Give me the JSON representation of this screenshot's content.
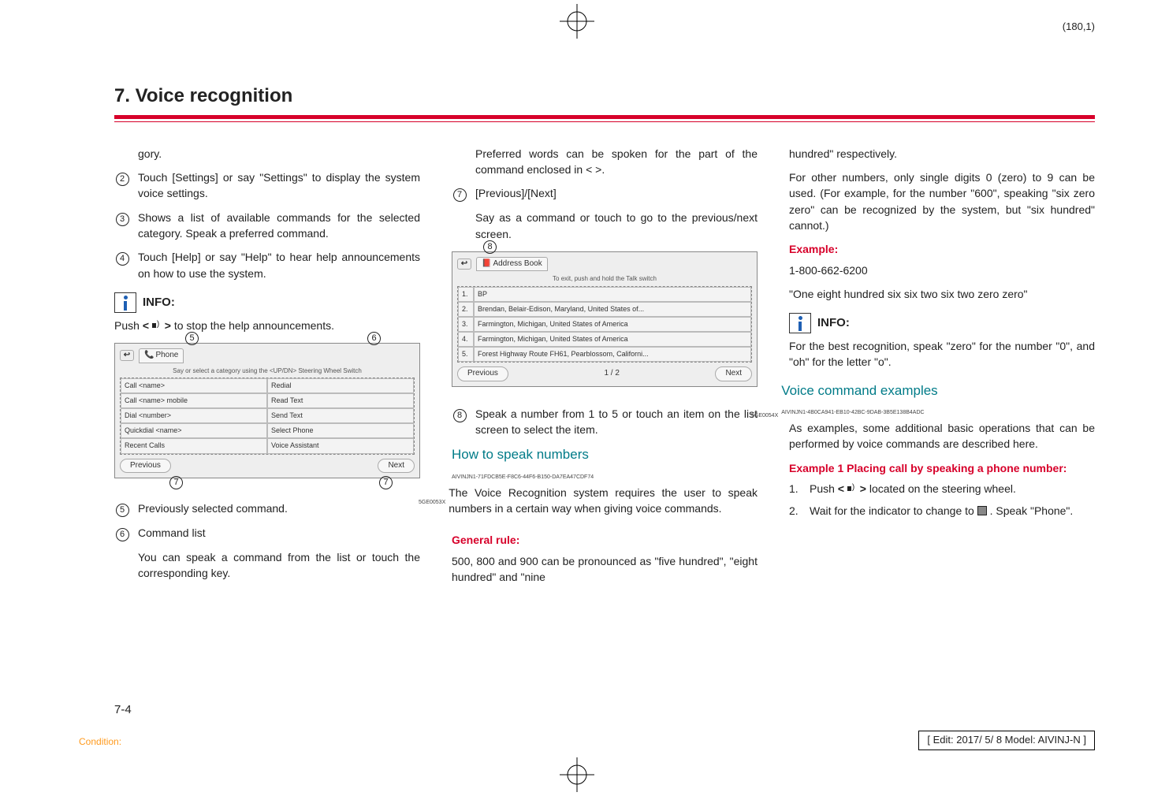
{
  "page_coord": "(180,1)",
  "chapter": "7. Voice recognition",
  "page_number": "7-4",
  "condition_label": "Condition:",
  "edit_line": "[ Edit: 2017/ 5/ 8    Model:  AIVINJ-N ]",
  "col1": {
    "gory": "gory.",
    "i2": "Touch [Settings] or say \"Settings\" to display the system voice settings.",
    "i3": "Shows a list of available commands for the selected category. Speak a preferred command.",
    "i4": "Touch [Help] or say \"Help\" to hear help announcements on how to use the system.",
    "info_label": "INFO:",
    "info_text_pre": "Push ",
    "info_text_mid": " to stop the help announcements.",
    "bold_lt": "<",
    "bold_gt": ">",
    "ss1": {
      "tab": "Phone",
      "hint": "Say or select a category using the <UP/DN> Steering Wheel Switch",
      "r1a": "Call <name>",
      "r1b": "Redial",
      "r2a": "Call <name> mobile",
      "r2b": "Read Text",
      "r3a": "Dial <number>",
      "r3b": "Send Text",
      "r4a": "Quickdial <name>",
      "r4b": "Select Phone",
      "r5a": "Recent Calls",
      "r5b": "Voice Assistant",
      "prev": "Previous",
      "next": "Next",
      "c5": "5",
      "c6": "6",
      "c7": "7"
    },
    "i5": "Previously selected command.",
    "i6": "Command list",
    "i6b": "You can speak a command from the list or touch the corresponding key."
  },
  "col2": {
    "p1": "Preferred words can be spoken for the part of the command enclosed in < >.",
    "i7a": "[Previous]/[Next]",
    "i7b": "Say as a command or touch to go to the previous/next screen.",
    "ss2": {
      "tab": "Address Book",
      "hint": "To exit, push and hold the Talk switch",
      "r1": "BP",
      "r2": "Brendan, Belair-Edison, Maryland, United States of...",
      "r3": "Farmington, Michigan, United States of America",
      "r4": "Farmington, Michigan, United States of America",
      "r5": "Forest Highway Route FH61, Pearblossom, Californi...",
      "prev": "Previous",
      "next": "Next",
      "page": "1 / 2",
      "c8": "8"
    },
    "img2_id": "5GE0053X",
    "i8": "Speak a number from 1 to 5 or touch an item on the list screen to select the item.",
    "h_speak": "How to speak numbers",
    "h_speak_id": "AIVINJN1-71FDCB5E-F8C6-44F6-B150-DA7EA47CDF74",
    "p_speak": "The Voice Recognition system requires the user to speak numbers in a certain way when giving voice commands.",
    "h_general": "General rule:",
    "p_general": "500, 800 and 900 can be pronounced as \"five hundred\", \"eight hundred\" and \"nine"
  },
  "col3": {
    "p1": "hundred\" respectively.",
    "p2": "For other numbers, only single digits 0 (zero) to 9 can be used. (For example, for the number \"600\", speaking \"six zero zero\" can be recognized by the system, but \"six hundred\" cannot.)",
    "h_example": "Example:",
    "ex1": "1-800-662-6200",
    "ex2": "\"One eight hundred six six two six two zero zero\"",
    "info_label": "INFO:",
    "info_text": "For the best recognition, speak \"zero\" for the number \"0\", and \"oh\" for the letter \"o\".",
    "img3_id": "5GE0054X",
    "h_voice": "Voice command examples",
    "h_voice_id": "AIVINJN1-4B0CA941-EB10-42BC-9DAB-3B5E138B4ADC",
    "p_voice": "As examples, some additional basic operations that can be performed by voice commands are described here.",
    "h_ex1": "Example 1 Placing call by speaking a phone number:",
    "l1_pre": "Push ",
    "l1_post": " located on the steering wheel.",
    "l2": "Wait for the indicator to change to      . Speak \"Phone\"."
  },
  "markers": {
    "m2": "2",
    "m3": "3",
    "m4": "4",
    "m5": "5",
    "m6": "6",
    "m7": "7",
    "m8": "8",
    "n1": "1.",
    "n2": "2."
  }
}
